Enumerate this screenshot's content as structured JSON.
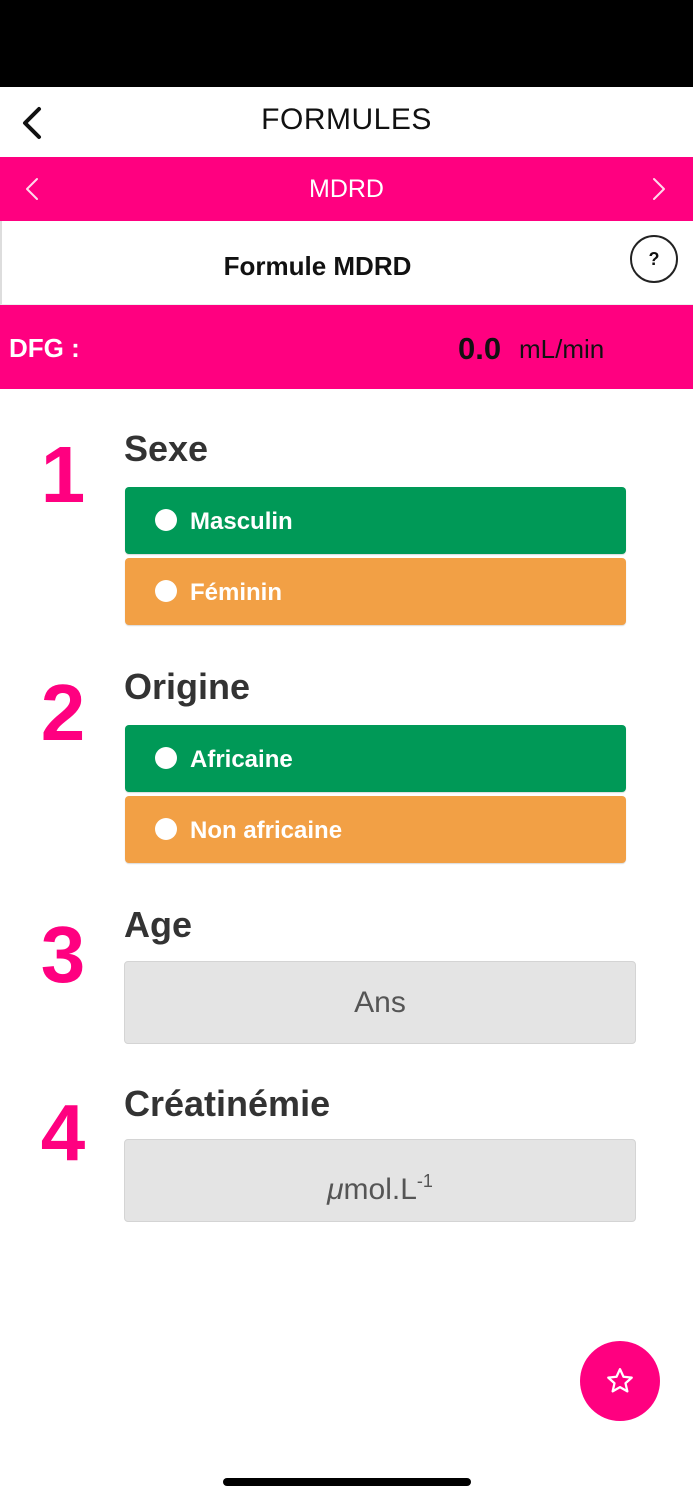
{
  "nav": {
    "title": "FORMULES",
    "back_icon": "chevron-left-icon"
  },
  "formula_bar": {
    "title": "MDRD",
    "prev_icon": "chevron-left-icon",
    "next_icon": "chevron-right-icon"
  },
  "subheader": {
    "title": "Formule MDRD",
    "help_label": "?"
  },
  "result": {
    "label": "DFG :",
    "value": "0.0",
    "unit": "mL/min"
  },
  "steps": [
    {
      "number": "1",
      "title": "Sexe",
      "options": [
        {
          "label": "Masculin",
          "color": "#009957"
        },
        {
          "label": "Féminin",
          "color": "#f2a045"
        }
      ]
    },
    {
      "number": "2",
      "title": "Origine",
      "options": [
        {
          "label": "Africaine",
          "color": "#009957"
        },
        {
          "label": "Non africaine",
          "color": "#f2a045"
        }
      ]
    },
    {
      "number": "3",
      "title": "Age",
      "placeholder": "Ans"
    },
    {
      "number": "4",
      "title": "Créatinémie",
      "placeholder_prefix": "μ",
      "placeholder_main": "mol.L",
      "placeholder_sup": "-1"
    }
  ],
  "fab": {
    "icon": "star-icon"
  },
  "colors": {
    "accent": "#ff0080",
    "green": "#009957",
    "orange": "#f2a045"
  }
}
